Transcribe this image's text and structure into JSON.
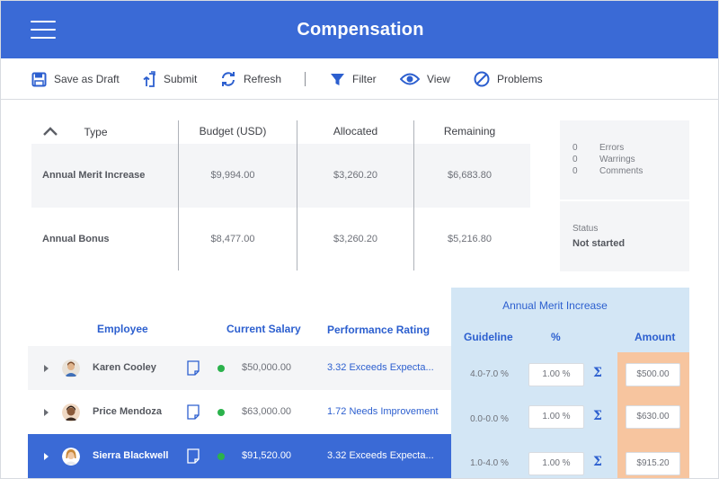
{
  "header": {
    "title": "Compensation"
  },
  "toolbar": {
    "save_draft": "Save as Draft",
    "submit": "Submit",
    "refresh": "Refresh",
    "filter": "Filter",
    "view": "View",
    "problems": "Problems"
  },
  "summary": {
    "columns": {
      "type": "Type",
      "budget": "Budget (USD)",
      "allocated": "Allocated",
      "remaining": "Remaining"
    },
    "rows": [
      {
        "type": "Annual Merit Increase",
        "budget": "$9,994.00",
        "allocated": "$3,260.20",
        "remaining": "$6,683.80"
      },
      {
        "type": "Annual Bonus",
        "budget": "$8,477.00",
        "allocated": "$3,260.20",
        "remaining": "$5,216.80"
      }
    ],
    "issues": [
      {
        "count": "0",
        "label": "Errors"
      },
      {
        "count": "0",
        "label": "Warrings"
      },
      {
        "count": "0",
        "label": "Comments"
      }
    ],
    "status_label": "Status",
    "status_value": "Not started"
  },
  "employees": {
    "headers": {
      "employee": "Employee",
      "current_salary": "Current Salary",
      "performance_rating": "Performance Rating",
      "merit_group": "Annual Merit Increase",
      "guideline": "Guideline",
      "percent": "%",
      "amount": "Amount"
    },
    "rows": [
      {
        "name": "Karen Cooley",
        "salary": "$50,000.00",
        "rating": "3.32 Exceeds Expecta...",
        "guideline": "4.0-7.0 %",
        "percent": "1.00 %",
        "amount": "$500.00",
        "status_color": "#2bb24c"
      },
      {
        "name": "Price Mendoza",
        "salary": "$63,000.00",
        "rating": "1.72 Needs Improvement",
        "guideline": "0.0-0.0 %",
        "percent": "1.00 %",
        "amount": "$630.00",
        "status_color": "#2bb24c"
      },
      {
        "name": "Sierra Blackwell",
        "salary": "$91,520.00",
        "rating": "3.32 Exceeds Expecta...",
        "guideline": "1.0-4.0 %",
        "percent": "1.00 %",
        "amount": "$915.20",
        "status_color": "#2bb24c"
      }
    ],
    "sigma": "Σ"
  },
  "colors": {
    "brand": "#3a6ad6",
    "accent_orange": "#ef7d33",
    "merit_panel": "#d3e6f5",
    "amount_panel": "#f7c59f",
    "status_green": "#2bb24c"
  },
  "icons": [
    "menu-icon",
    "save-icon",
    "submit-icon",
    "refresh-icon",
    "filter-icon",
    "view-icon",
    "problems-icon",
    "chevron-up-icon",
    "expand-icon",
    "avatar",
    "document-icon",
    "sigma-icon"
  ]
}
